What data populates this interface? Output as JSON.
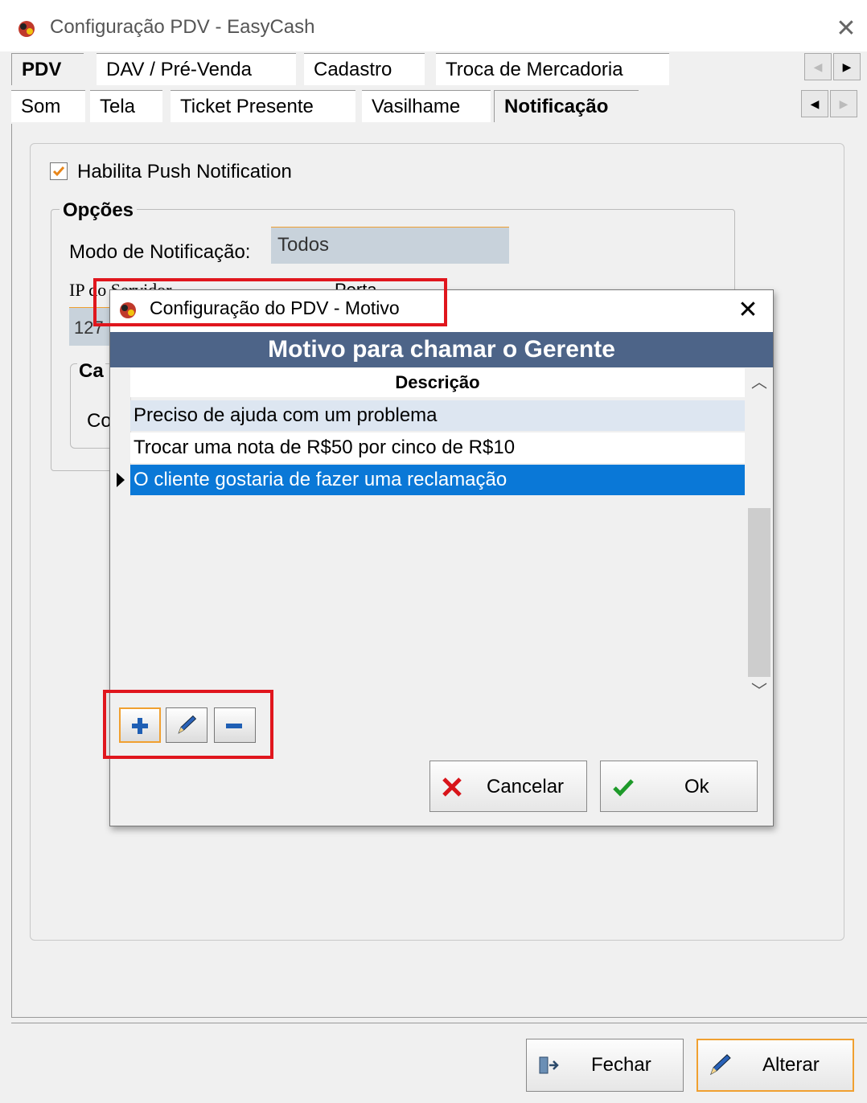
{
  "window": {
    "title": "Configuração PDV - EasyCash",
    "close_label": "✕"
  },
  "tabs_row1": [
    "PDV",
    "DAV / Pré-Venda",
    "Cadastro",
    "Troca de Mercadoria"
  ],
  "tabs_row2": [
    "Som",
    "Tela",
    "Ticket Presente",
    "Vasilhame",
    "Notificação"
  ],
  "active_tabs": [
    "PDV",
    "Notificação"
  ],
  "notificacao": {
    "push_checkbox_label": "Habilita Push Notification",
    "push_checked": true,
    "opcoes_title": "Opções",
    "modo_label": "Modo de Notificação:",
    "modo_value": "Todos",
    "ip_label": "IP do Servidor",
    "porta_label": "Porta",
    "ip_value": "127",
    "cat_title": "Ca",
    "co_label": "Co"
  },
  "footer": {
    "close_button": "Fechar",
    "change_button": "Alterar"
  },
  "dialog": {
    "title": "Configuração do PDV - Motivo",
    "close_label": "✕",
    "header": "Motivo para chamar o Gerente",
    "column_header": "Descrição",
    "rows": [
      "Preciso de ajuda com um problema",
      "Trocar uma nota de R$50 por cinco de R$10",
      "O cliente gostaria de fazer uma reclamação"
    ],
    "selected_row": 2,
    "cancel_button": "Cancelar",
    "ok_button": "Ok"
  },
  "colors": {
    "dialog_header_bg": "#4d6488",
    "selected_row_bg": "#0a78d7",
    "highlight_border": "#e0161d",
    "field_bg": "#c8d2db"
  }
}
